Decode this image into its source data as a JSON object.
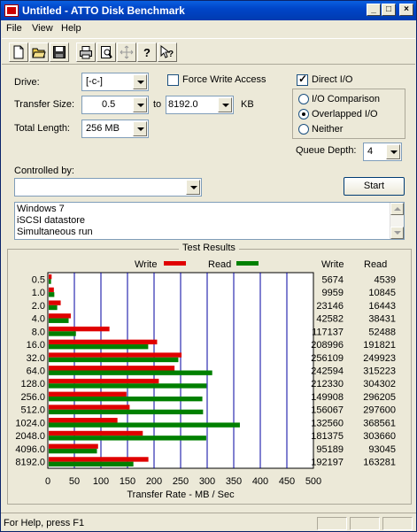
{
  "window": {
    "title": "Untitled - ATTO Disk Benchmark"
  },
  "menu": [
    "File",
    "View",
    "Help"
  ],
  "toolbar": {
    "icons": [
      "new-file-icon",
      "open-folder-icon",
      "save-icon",
      "print-icon",
      "print-preview-icon",
      "move-icon",
      "help-icon",
      "context-help-icon"
    ]
  },
  "form": {
    "drive_label": "Drive:",
    "drive_value": "[-c-]",
    "force_write_label": "Force Write Access",
    "force_write_checked": false,
    "direct_io_label": "Direct I/O",
    "direct_io_checked": true,
    "transfer_size_label": "Transfer Size:",
    "transfer_from": "0.5",
    "to_label": "to",
    "transfer_to": "8192.0",
    "kb_label": "KB",
    "total_length_label": "Total Length:",
    "total_length_value": "256 MB",
    "io_options": [
      "I/O Comparison",
      "Overlapped I/O",
      "Neither"
    ],
    "io_selected": "Overlapped I/O",
    "queue_depth_label": "Queue Depth:",
    "queue_depth_value": "4",
    "controlled_by_label": "Controlled by:",
    "controlled_by_value": "",
    "start_label": "Start",
    "description_lines": [
      "Windows 7",
      "iSCSI datastore",
      "Simultaneous run"
    ]
  },
  "results": {
    "title": "Test Results",
    "write_label": "Write",
    "read_label": "Read",
    "write_col": "Write",
    "read_col": "Read",
    "write_color": "#e00000",
    "read_color": "#008000"
  },
  "chart_data": {
    "type": "bar",
    "orientation": "horizontal",
    "categories": [
      "0.5",
      "1.0",
      "2.0",
      "4.0",
      "8.0",
      "16.0",
      "32.0",
      "64.0",
      "128.0",
      "256.0",
      "512.0",
      "1024.0",
      "2048.0",
      "4096.0",
      "8192.0"
    ],
    "series": [
      {
        "name": "Write",
        "values": [
          5674,
          9959,
          23146,
          42582,
          117137,
          208996,
          256109,
          242594,
          212330,
          149908,
          156067,
          132560,
          181375,
          95189,
          192197
        ]
      },
      {
        "name": "Read",
        "values": [
          4539,
          10845,
          16443,
          38431,
          52488,
          191821,
          249923,
          315223,
          304302,
          296205,
          297600,
          368561,
          303660,
          93045,
          163281
        ]
      }
    ],
    "xlabel": "Transfer Rate - MB / Sec",
    "xticks": [
      "0",
      "50",
      "100",
      "150",
      "200",
      "250",
      "300",
      "350",
      "400",
      "450",
      "500"
    ],
    "xlim": [
      0,
      500
    ],
    "grid": true,
    "legend": "top"
  },
  "statusbar": {
    "text": "For Help, press F1"
  }
}
